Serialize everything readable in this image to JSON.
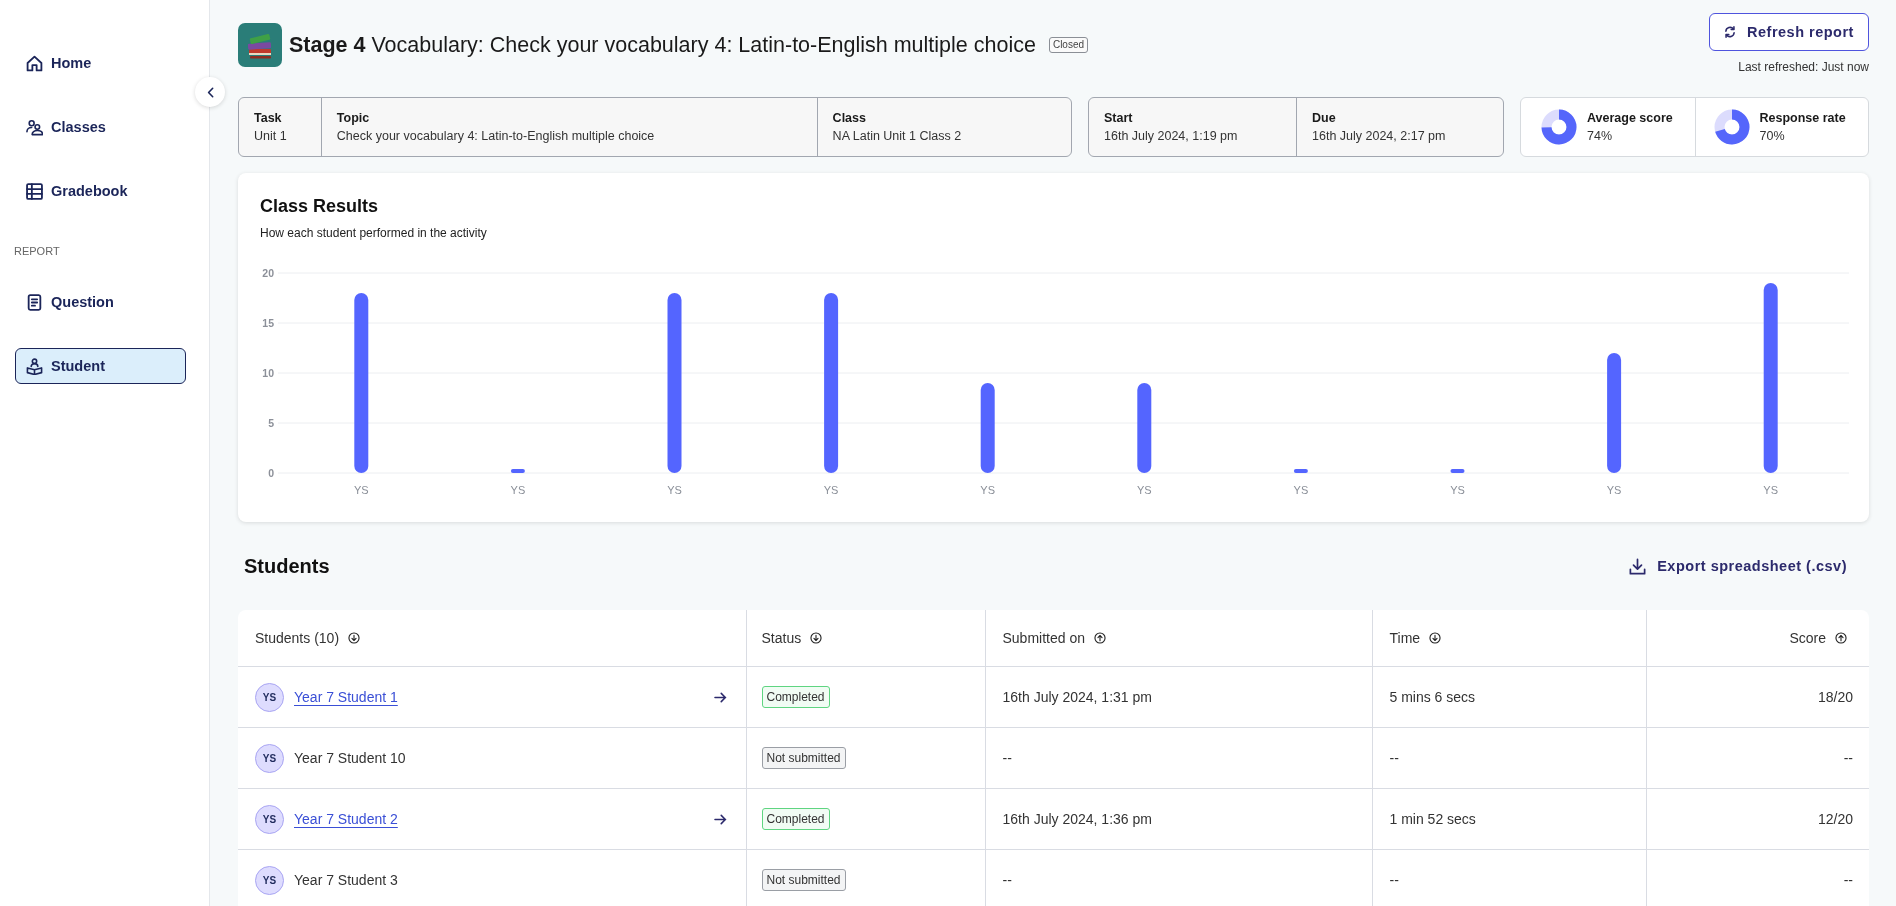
{
  "sidebar": {
    "items": [
      {
        "label": "Home",
        "selected": false
      },
      {
        "label": "Classes",
        "selected": false
      },
      {
        "label": "Gradebook",
        "selected": false
      }
    ],
    "section": {
      "label": "REPORT",
      "items": [
        {
          "label": "Question",
          "selected": false
        },
        {
          "label": "Student",
          "selected": true
        }
      ]
    }
  },
  "header": {
    "title": "**Stage 4** Vocabulary: Check your vocabulary 4: Latin-to-English multiple choice",
    "badge": "Closed",
    "refresh_button": "Refresh report",
    "last_refreshed": "Last refreshed: Just now"
  },
  "details": [
    {
      "fields": [
        {
          "label": "Task",
          "value": "Unit 1"
        },
        {
          "label": "Topic",
          "value": "Check your vocabulary 4: Latin-to-English multiple choice"
        },
        {
          "label": "Class",
          "value": "NA Latin Unit 1 Class 2"
        }
      ]
    },
    {
      "fields": [
        {
          "label": "Start",
          "value": "16th July 2024, 1:19 pm"
        },
        {
          "label": "Due",
          "value": "16th July 2024, 2:17 pm"
        }
      ]
    }
  ],
  "stats": [
    {
      "label": "Average score",
      "value": "74%",
      "level": 0.74
    },
    {
      "label": "Response rate",
      "value": "70%",
      "level": 0.7
    }
  ],
  "class_results": {
    "title": "Class Results",
    "subtitle": "How each student performed in the activity",
    "chart_data": {
      "type": "bar",
      "categories": [
        "YS",
        "YS",
        "YS",
        "YS",
        "YS",
        "YS",
        "YS",
        "YS",
        "YS",
        "YS"
      ],
      "values": [
        18,
        0,
        18,
        18,
        9,
        9,
        0,
        0,
        12,
        19
      ],
      "ylim": [
        0,
        20
      ],
      "yticks": [
        0,
        5,
        10,
        15,
        20
      ],
      "grid": true
    }
  },
  "students": {
    "title": "Students",
    "export_button": "Export spreadsheet (.csv)",
    "table": {
      "columns": [
        {
          "label": "Students (10)",
          "sort_descending": true
        },
        {
          "label": "Status",
          "sort_descending": true
        },
        {
          "label": "Submitted on",
          "sort_descending": false
        },
        {
          "label": "Time",
          "sort_descending": true
        },
        {
          "label": "Score",
          "sort_descending": false
        }
      ],
      "rows": [
        {
          "initials": "YS",
          "name": "Year 7 Student 1",
          "submitted": true,
          "status": "Completed",
          "submitted_on": "16th July 2024, 1:31 pm",
          "time": "5 mins 6 secs",
          "score": "18/20"
        },
        {
          "initials": "YS",
          "name": "Year 7 Student 10",
          "submitted": false,
          "status": "Not submitted",
          "submitted_on": "--",
          "time": "--",
          "score": "--"
        },
        {
          "initials": "YS",
          "name": "Year 7 Student 2",
          "submitted": true,
          "status": "Completed",
          "submitted_on": "16th July 2024, 1:36 pm",
          "time": "1 min 52 secs",
          "score": "12/20"
        },
        {
          "initials": "YS",
          "name": "Year 7 Student 3",
          "submitted": false,
          "status": "Not submitted",
          "submitted_on": "--",
          "time": "--",
          "score": "--"
        }
      ]
    }
  }
}
